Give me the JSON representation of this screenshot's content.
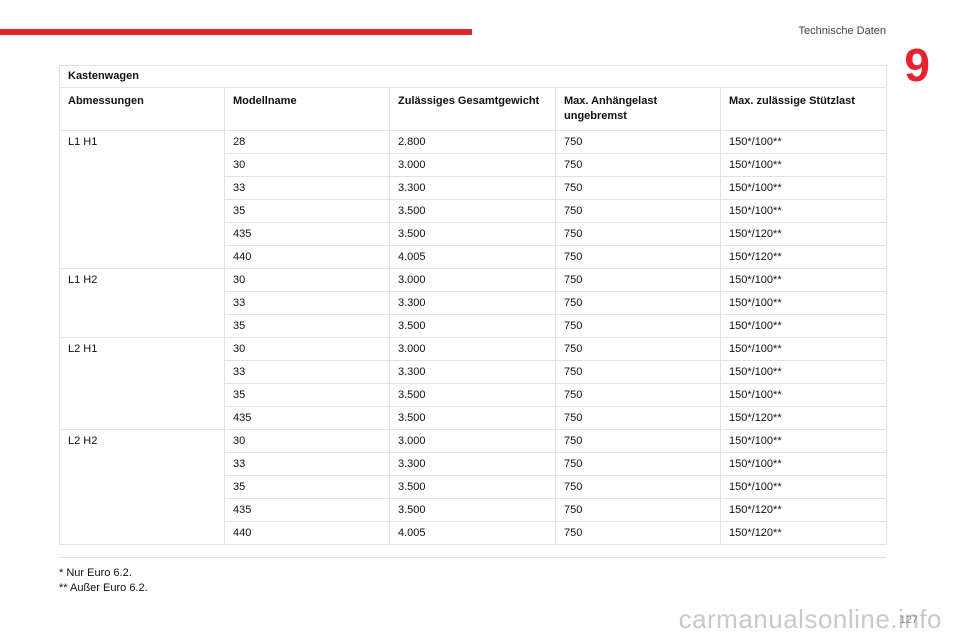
{
  "header": {
    "title": "Technische Daten",
    "chapter": "9"
  },
  "table": {
    "title": "Kastenwagen",
    "columns": [
      "Abmessungen",
      "Modellname",
      "Zulässiges Gesamtgewicht",
      "Max. Anhängelast ungebremst",
      "Max. zulässige Stützlast"
    ],
    "groups": [
      {
        "dimension": "L1 H1",
        "rows": [
          [
            "28",
            "2.800",
            "750",
            "150*/100**"
          ],
          [
            "30",
            "3.000",
            "750",
            "150*/100**"
          ],
          [
            "33",
            "3.300",
            "750",
            "150*/100**"
          ],
          [
            "35",
            "3.500",
            "750",
            "150*/100**"
          ],
          [
            "435",
            "3.500",
            "750",
            "150*/120**"
          ],
          [
            "440",
            "4.005",
            "750",
            "150*/120**"
          ]
        ]
      },
      {
        "dimension": "L1 H2",
        "rows": [
          [
            "30",
            "3.000",
            "750",
            "150*/100**"
          ],
          [
            "33",
            "3.300",
            "750",
            "150*/100**"
          ],
          [
            "35",
            "3.500",
            "750",
            "150*/100**"
          ]
        ]
      },
      {
        "dimension": "L2 H1",
        "rows": [
          [
            "30",
            "3.000",
            "750",
            "150*/100**"
          ],
          [
            "33",
            "3.300",
            "750",
            "150*/100**"
          ],
          [
            "35",
            "3.500",
            "750",
            "150*/100**"
          ],
          [
            "435",
            "3.500",
            "750",
            "150*/120**"
          ]
        ]
      },
      {
        "dimension": "L2 H2",
        "rows": [
          [
            "30",
            "3.000",
            "750",
            "150*/100**"
          ],
          [
            "33",
            "3.300",
            "750",
            "150*/100**"
          ],
          [
            "35",
            "3.500",
            "750",
            "150*/100**"
          ],
          [
            "435",
            "3.500",
            "750",
            "150*/120**"
          ],
          [
            "440",
            "4.005",
            "750",
            "150*/120**"
          ]
        ]
      }
    ]
  },
  "footnotes": [
    "* Nur Euro 6.2.",
    "** Außer Euro 6.2."
  ],
  "page_number": "127",
  "watermark": "carmanualsonline.info"
}
